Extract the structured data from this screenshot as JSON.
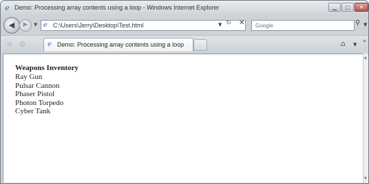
{
  "window": {
    "title": "Demo: Processing array contents using a loop - Windows Internet Explorer"
  },
  "navigation": {
    "address": "C:\\Users\\Jerry\\Desktop\\Test.html",
    "search_placeholder": "Google"
  },
  "tabs": [
    {
      "label": "Demo: Processing array contents using a loop"
    }
  ],
  "page": {
    "heading": "Weapons Inventory",
    "items": [
      "Ray Gun",
      "Pulsar Cannon",
      "Phaser Pistol",
      "Photon Torpedo",
      "Cyber Tank"
    ]
  },
  "icons": {
    "browser": "ie-icon",
    "back": "back-arrow-icon",
    "forward": "forward-arrow-icon",
    "refresh": "refresh-icon",
    "stop": "stop-icon",
    "search": "search-icon",
    "favorites": "favorites-star-icon",
    "add_favorites": "add-favorites-icon",
    "home": "home-icon"
  }
}
